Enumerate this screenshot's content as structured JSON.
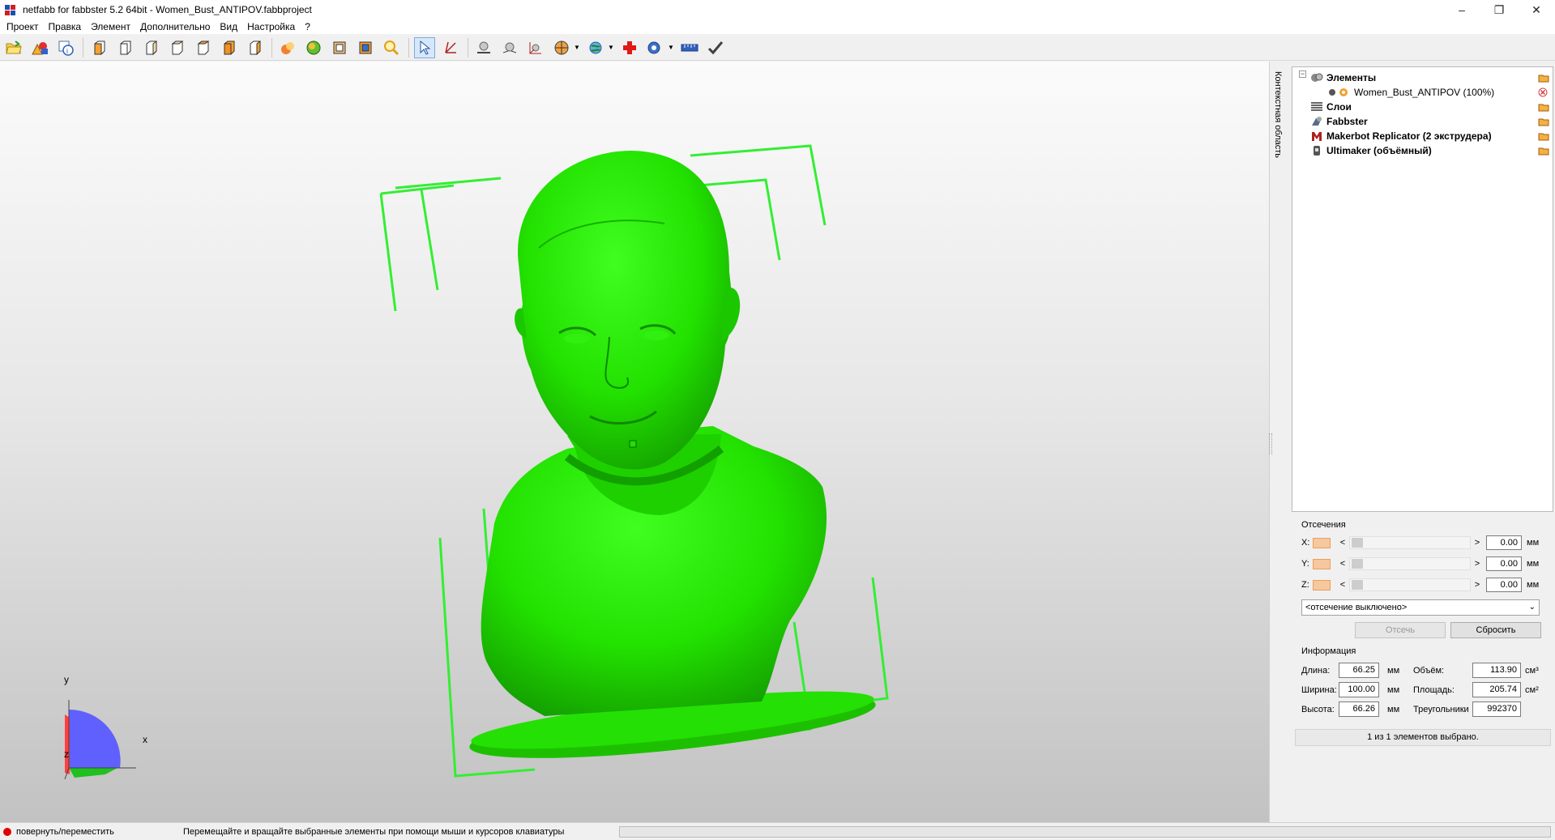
{
  "window": {
    "title": "netfabb for fabbster 5.2 64bit - Women_Bust_ANTIPOV.fabbproject",
    "minimize_glyph": "–",
    "restore_glyph": "❐",
    "close_glyph": "✕"
  },
  "menu": [
    "Проект",
    "Правка",
    "Элемент",
    "Дополнительно",
    "Вид",
    "Настройка",
    "?"
  ],
  "viewport": {
    "model_color": "#22e000",
    "box_color": "#33ee33",
    "axis_labels": {
      "x": "x",
      "y": "y",
      "z": "z"
    }
  },
  "side_tab": {
    "label": "Контекстная область"
  },
  "tree": {
    "rows": [
      {
        "label": "Элементы",
        "bold": true
      },
      {
        "label": "Women_Bust_ANTIPOV (100%)",
        "bold": false
      },
      {
        "label": "Слои",
        "bold": true
      },
      {
        "label": "Fabbster",
        "bold": true
      },
      {
        "label": "Makerbot Replicator (2 экструдера)",
        "bold": true
      },
      {
        "label": "Ultimaker (объёмный)",
        "bold": true
      }
    ],
    "expander_glyph": "−"
  },
  "cuts": {
    "title": "Отсечения",
    "rows": [
      {
        "axis": "X:",
        "value": "0.00",
        "unit": "мм"
      },
      {
        "axis": "Y:",
        "value": "0.00",
        "unit": "мм"
      },
      {
        "axis": "Z:",
        "value": "0.00",
        "unit": "мм"
      }
    ],
    "left_arrow": "<",
    "right_arrow": ">",
    "mode": "<отсечение выключено>",
    "caret": "⌄",
    "cut_button": "Отсечь",
    "reset_button": "Сбросить"
  },
  "info": {
    "title": "Информация",
    "length_label": "Длина:",
    "length_value": "66.25",
    "length_unit": "мм",
    "width_label": "Ширина:",
    "width_value": "100.00",
    "width_unit": "мм",
    "height_label": "Высота:",
    "height_value": "66.26",
    "height_unit": "мм",
    "volume_label": "Объём:",
    "volume_value": "113.90",
    "volume_unit": "см³",
    "area_label": "Площадь:",
    "area_value": "205.74",
    "area_unit": "см²",
    "triangles_label": "Треугольники",
    "triangles_value": "992370"
  },
  "selection_status": "1 из 1 элементов выбрано.",
  "status": {
    "mode": "повернуть/переместить",
    "hint": "Перемещайте и вращайте выбранные элементы при помощи мыши и курсоров клавиатуры",
    "status_color": "#e00000"
  },
  "colors": {
    "accent": "#7aa9e0",
    "orange": "#f0a030"
  }
}
